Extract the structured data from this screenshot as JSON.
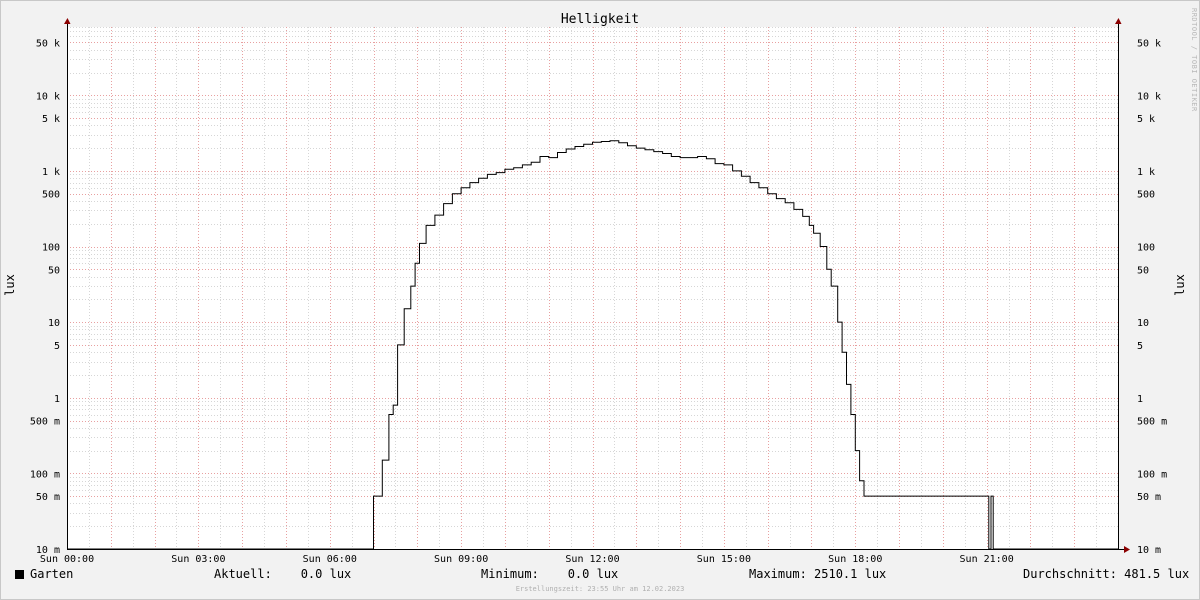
{
  "chart_data": {
    "type": "line",
    "title": "Helligkeit",
    "ylabel": "lux",
    "y_scale": "log",
    "ylim": [
      0.01,
      80000
    ],
    "xlim": [
      0,
      24
    ],
    "y_ticks": [
      {
        "value": 0.01,
        "label": "10 m"
      },
      {
        "value": 0.05,
        "label": "50 m"
      },
      {
        "value": 0.1,
        "label": "100 m"
      },
      {
        "value": 0.5,
        "label": "500 m"
      },
      {
        "value": 1,
        "label": "1"
      },
      {
        "value": 5,
        "label": "5"
      },
      {
        "value": 10,
        "label": "10"
      },
      {
        "value": 50,
        "label": "50"
      },
      {
        "value": 100,
        "label": "100"
      },
      {
        "value": 500,
        "label": "500"
      },
      {
        "value": 1000,
        "label": "1 k"
      },
      {
        "value": 5000,
        "label": "5 k"
      },
      {
        "value": 10000,
        "label": "10 k"
      },
      {
        "value": 50000,
        "label": "50 k"
      }
    ],
    "x_ticks": [
      {
        "value": 0,
        "label": "Sun 00:00"
      },
      {
        "value": 3,
        "label": "Sun 03:00"
      },
      {
        "value": 6,
        "label": "Sun 06:00"
      },
      {
        "value": 9,
        "label": "Sun 09:00"
      },
      {
        "value": 12,
        "label": "Sun 12:00"
      },
      {
        "value": 15,
        "label": "Sun 15:00"
      },
      {
        "value": 18,
        "label": "Sun 18:00"
      },
      {
        "value": 21,
        "label": "Sun 21:00"
      }
    ],
    "grid": true,
    "series": [
      {
        "name": "Garten",
        "color": "#000000",
        "points": [
          [
            0,
            0.01
          ],
          [
            6.95,
            0.01
          ],
          [
            7.0,
            0.05
          ],
          [
            7.2,
            0.15
          ],
          [
            7.35,
            0.6
          ],
          [
            7.45,
            0.8
          ],
          [
            7.55,
            5
          ],
          [
            7.7,
            15
          ],
          [
            7.85,
            30
          ],
          [
            7.95,
            60
          ],
          [
            8.05,
            110
          ],
          [
            8.2,
            190
          ],
          [
            8.4,
            260
          ],
          [
            8.6,
            370
          ],
          [
            8.8,
            500
          ],
          [
            9.0,
            600
          ],
          [
            9.2,
            700
          ],
          [
            9.4,
            800
          ],
          [
            9.6,
            900
          ],
          [
            9.8,
            950
          ],
          [
            10.0,
            1050
          ],
          [
            10.2,
            1100
          ],
          [
            10.4,
            1200
          ],
          [
            10.6,
            1300
          ],
          [
            10.8,
            1550
          ],
          [
            11.0,
            1500
          ],
          [
            11.2,
            1750
          ],
          [
            11.4,
            1950
          ],
          [
            11.6,
            2100
          ],
          [
            11.8,
            2250
          ],
          [
            12.0,
            2400
          ],
          [
            12.2,
            2450
          ],
          [
            12.4,
            2510
          ],
          [
            12.6,
            2350
          ],
          [
            12.8,
            2150
          ],
          [
            13.0,
            2000
          ],
          [
            13.2,
            1900
          ],
          [
            13.4,
            1800
          ],
          [
            13.6,
            1700
          ],
          [
            13.8,
            1550
          ],
          [
            14.0,
            1500
          ],
          [
            14.2,
            1500
          ],
          [
            14.4,
            1550
          ],
          [
            14.6,
            1450
          ],
          [
            14.8,
            1250
          ],
          [
            15.0,
            1200
          ],
          [
            15.2,
            1000
          ],
          [
            15.4,
            850
          ],
          [
            15.6,
            700
          ],
          [
            15.8,
            600
          ],
          [
            16.0,
            500
          ],
          [
            16.2,
            430
          ],
          [
            16.4,
            380
          ],
          [
            16.6,
            310
          ],
          [
            16.8,
            250
          ],
          [
            16.95,
            190
          ],
          [
            17.05,
            150
          ],
          [
            17.2,
            100
          ],
          [
            17.35,
            50
          ],
          [
            17.45,
            30
          ],
          [
            17.6,
            10
          ],
          [
            17.7,
            4
          ],
          [
            17.8,
            1.5
          ],
          [
            17.9,
            0.6
          ],
          [
            18.0,
            0.2
          ],
          [
            18.1,
            0.08
          ],
          [
            18.2,
            0.05
          ],
          [
            21.0,
            0.05
          ],
          [
            21.05,
            0.01
          ],
          [
            21.1,
            0.05
          ],
          [
            21.15,
            0.01
          ],
          [
            24,
            0.01
          ]
        ]
      }
    ],
    "legend": {
      "series_name": "Garten",
      "current": "Aktuell:    0.0 lux",
      "minimum": "Minimum:    0.0 lux",
      "maximum": "Maximum: 2510.1 lux",
      "average": "Durchschnitt: 481.5 lux"
    }
  },
  "watermark": "RRDTOOL / TOBI OETIKER",
  "footer": "Erstellungszeit: 23:55 Uhr am 12.02.2023",
  "colors": {
    "background": "#f2f2f2",
    "plot_background": "#ffffff",
    "minor_grid": "#d6d6d6",
    "major_grid": "#e8a0a0",
    "axis": "#000000",
    "arrow": "#8b0000",
    "line": "#000000"
  }
}
